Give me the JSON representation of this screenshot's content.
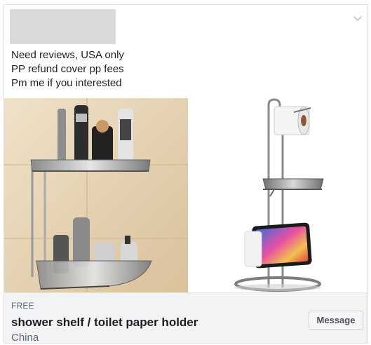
{
  "post": {
    "lines": [
      "Need reviews, USA only",
      "PP refund cover pp fees",
      "Pm me if you interested"
    ]
  },
  "listing": {
    "price": "FREE",
    "title": "shower shelf / toilet paper holder",
    "location": "China",
    "message_label": "Message"
  },
  "icons": {
    "menu": "chevron-down-icon"
  }
}
